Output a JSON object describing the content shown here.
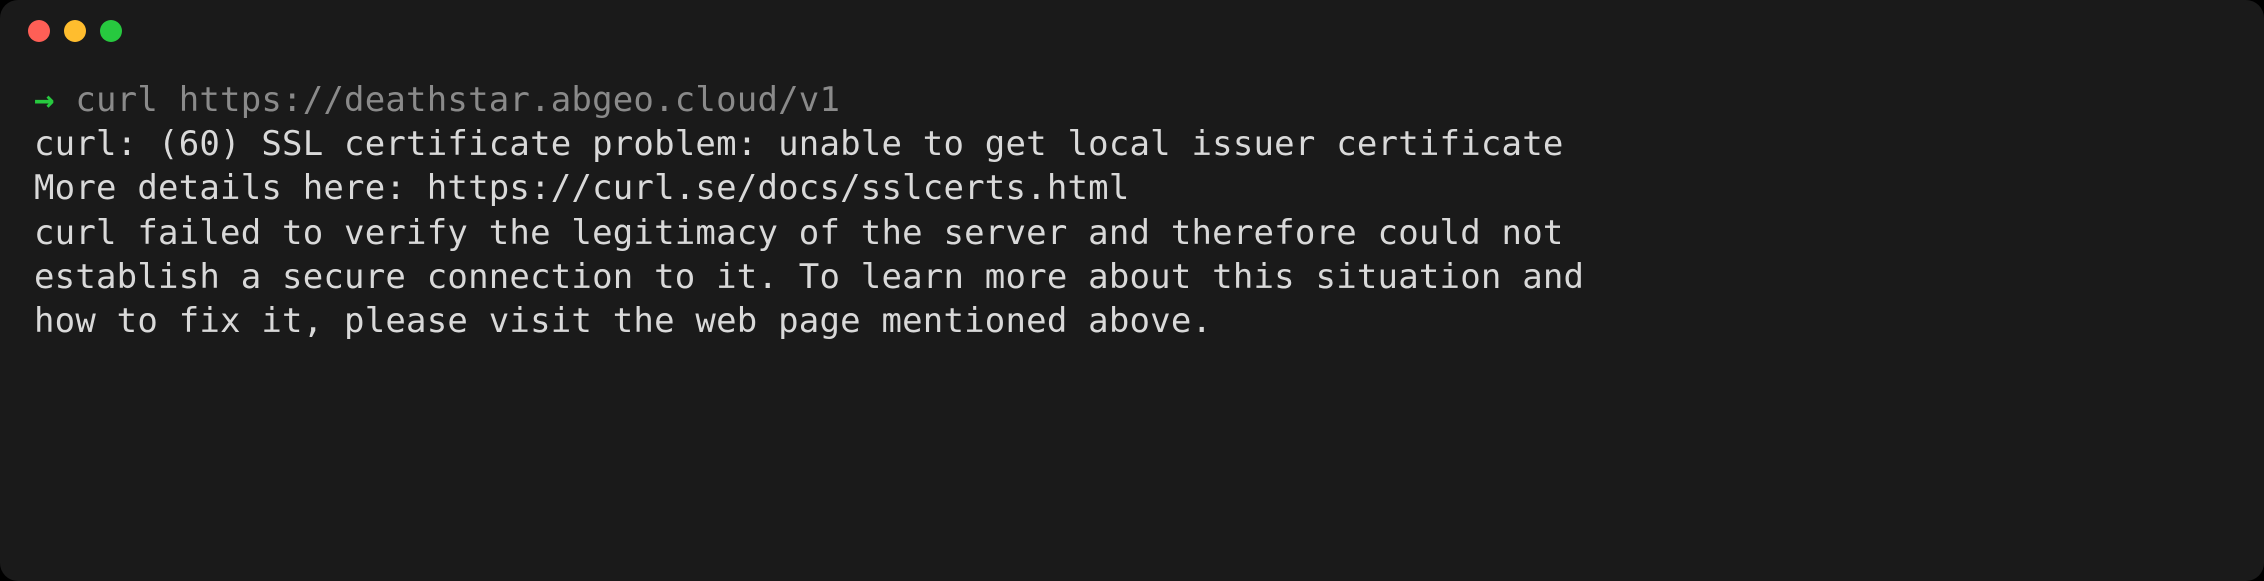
{
  "window": {
    "traffic_lights": [
      "close",
      "minimize",
      "zoom"
    ]
  },
  "prompt": {
    "arrow": "→",
    "command": "curl https://deathstar.abgeo.cloud/v1"
  },
  "output": {
    "line1": "curl: (60) SSL certificate problem: unable to get local issuer certificate",
    "line2": "More details here: https://curl.se/docs/sslcerts.html",
    "line3": "",
    "line4": "curl failed to verify the legitimacy of the server and therefore could not",
    "line5": "establish a secure connection to it. To learn more about this situation and",
    "line6": "how to fix it, please visit the web page mentioned above."
  }
}
